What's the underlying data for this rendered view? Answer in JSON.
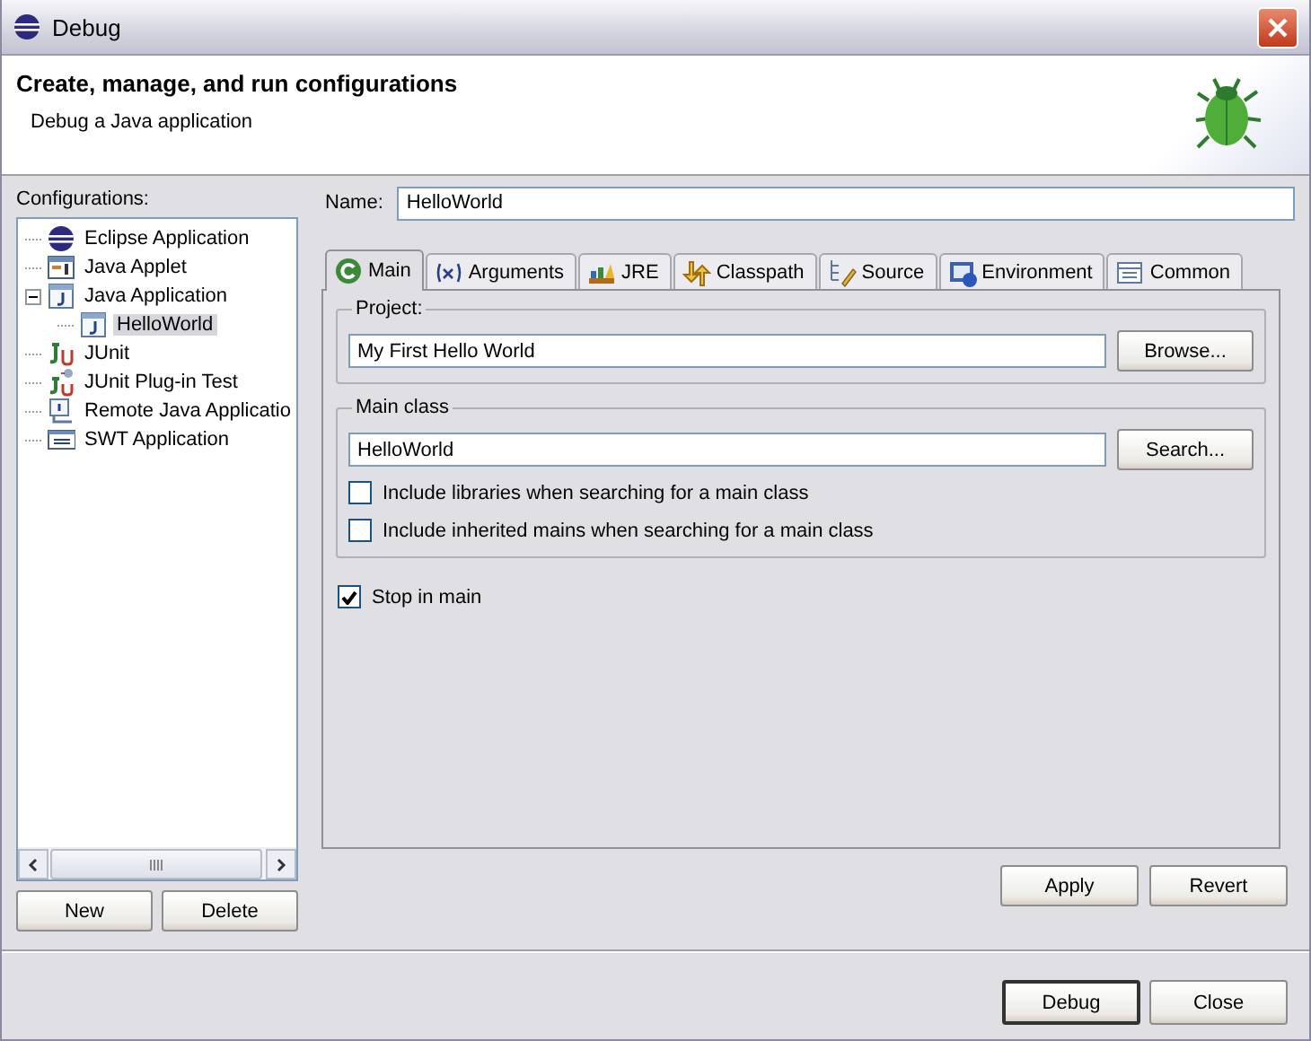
{
  "window": {
    "title": "Debug"
  },
  "header": {
    "title": "Create, manage, and run configurations",
    "subtitle": "Debug a Java application"
  },
  "configurations": {
    "label": "Configurations:",
    "items": [
      {
        "label": "Eclipse Application",
        "kind": "eclipse",
        "selected": false
      },
      {
        "label": "Java Applet",
        "kind": "applet",
        "selected": false
      },
      {
        "label": "Java Application",
        "kind": "java",
        "selected": false,
        "expanded": true,
        "children": [
          {
            "label": "HelloWorld",
            "kind": "java",
            "selected": true
          }
        ]
      },
      {
        "label": "JUnit",
        "kind": "junit",
        "selected": false
      },
      {
        "label": "JUnit Plug-in Test",
        "kind": "plugin",
        "selected": false
      },
      {
        "label": "Remote Java Applicatio",
        "kind": "remote",
        "selected": false
      },
      {
        "label": "SWT Application",
        "kind": "swt",
        "selected": false
      }
    ]
  },
  "left_buttons": [
    "New",
    "Delete"
  ],
  "name": {
    "label": "Name:",
    "value": "HelloWorld"
  },
  "tabs": [
    {
      "label": "Main",
      "kind": "main",
      "selected": true
    },
    {
      "label": "Arguments",
      "kind": "arguments",
      "selected": false
    },
    {
      "label": "JRE",
      "kind": "jre",
      "selected": false
    },
    {
      "label": "Classpath",
      "kind": "classpath",
      "selected": false
    },
    {
      "label": "Source",
      "kind": "source",
      "selected": false
    },
    {
      "label": "Environment",
      "kind": "environment",
      "selected": false
    },
    {
      "label": "Common",
      "kind": "common",
      "selected": false
    }
  ],
  "project": {
    "label": "Project:",
    "value": "My First Hello World",
    "button": "Browse..."
  },
  "main_class": {
    "label": "Main class",
    "value": "HelloWorld",
    "button": "Search...",
    "options": [
      {
        "label": "Include libraries when searching for a main class",
        "checked": false
      },
      {
        "label": "Include inherited mains when searching for a main class",
        "checked": false
      }
    ]
  },
  "stop_in_main": {
    "label": "Stop in main",
    "checked": true
  },
  "panel_buttons": [
    "Apply",
    "Revert"
  ],
  "dialog_buttons": [
    {
      "label": "Debug",
      "selected": true
    },
    {
      "label": "Close",
      "selected": false
    }
  ]
}
